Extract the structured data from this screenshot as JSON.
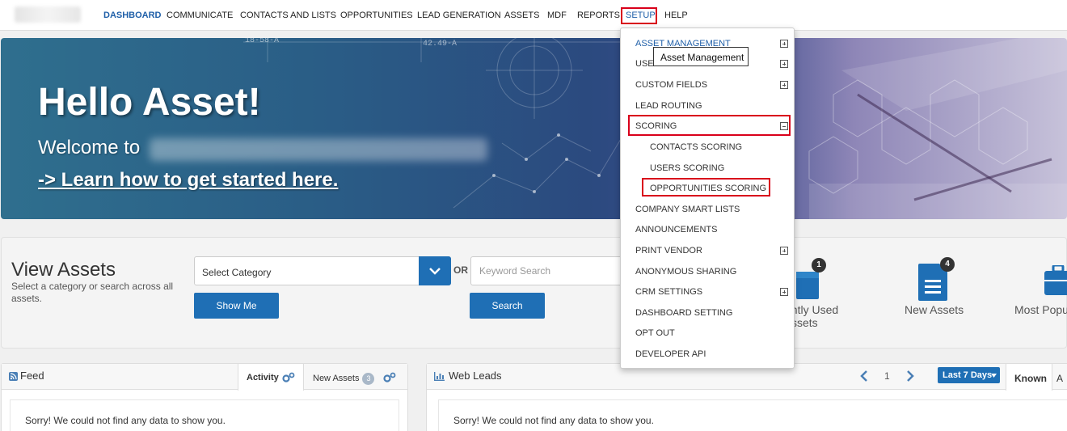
{
  "nav": {
    "items": [
      "DASHBOARD",
      "COMMUNICATE",
      "CONTACTS AND LISTS",
      "OPPORTUNITIES",
      "LEAD GENERATION",
      "ASSETS",
      "MDF",
      "REPORTS",
      "SETUP",
      "HELP"
    ]
  },
  "hero": {
    "title": "Hello Asset!",
    "welcome": "Welcome to",
    "link": "-> Learn how to get started here.",
    "coords": [
      "18-58-A",
      "42.49-A"
    ]
  },
  "view_assets": {
    "title": "View Assets",
    "subtitle": "Select a category or search across all assets.",
    "select_label": "Select Category",
    "or_label": "OR",
    "keyword_placeholder": "Keyword Search",
    "show_me_label": "Show Me",
    "search_label": "Search",
    "tiles": [
      {
        "label": "ently Used",
        "label2": "ssets",
        "badge": "1"
      },
      {
        "label": "New Assets",
        "badge": "4"
      },
      {
        "label": "Most Popul"
      }
    ]
  },
  "feed": {
    "title": "Feed",
    "tab_activity": "Activity",
    "tab_new_assets": "New Assets",
    "new_assets_count": "3",
    "empty": "Sorry! We could not find any data to show you."
  },
  "web_leads": {
    "title": "Web Leads",
    "page": "1",
    "range_label": "Last 7 Days",
    "tab_known": "Known",
    "tab_next": "A",
    "empty": "Sorry! We could not find any data to show you."
  },
  "setup_menu": {
    "items": [
      {
        "label": "ASSET MANAGEMENT",
        "expand": "plus"
      },
      {
        "label": "USER MANAGEMENT",
        "expand": "plus"
      },
      {
        "label": "CUSTOM FIELDS",
        "expand": "plus"
      },
      {
        "label": "LEAD ROUTING"
      },
      {
        "label": "SCORING",
        "expand": "minus"
      },
      {
        "label": "CONTACTS SCORING",
        "sub": true
      },
      {
        "label": "USERS SCORING",
        "sub": true
      },
      {
        "label": "OPPORTUNITIES SCORING",
        "sub": true
      },
      {
        "label": "COMPANY SMART LISTS"
      },
      {
        "label": "ANNOUNCEMENTS"
      },
      {
        "label": "PRINT VENDOR",
        "expand": "plus"
      },
      {
        "label": "ANONYMOUS SHARING"
      },
      {
        "label": "CRM SETTINGS",
        "expand": "plus"
      },
      {
        "label": "DASHBOARD SETTING"
      },
      {
        "label": "OPT OUT"
      },
      {
        "label": "DEVELOPER API"
      }
    ],
    "tooltip": "Asset Management"
  },
  "colors": {
    "accent": "#1f6fb5",
    "nav_active": "#1f5fa8",
    "highlight_red": "#d9001b"
  }
}
